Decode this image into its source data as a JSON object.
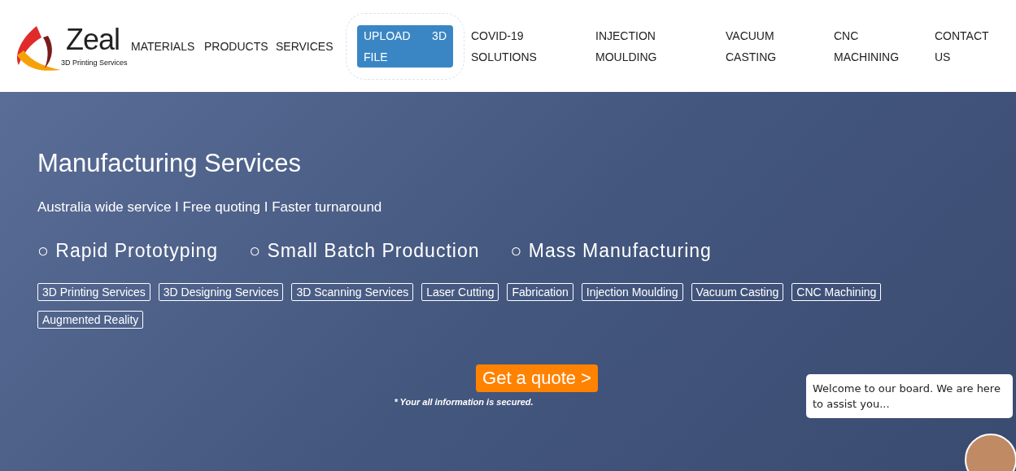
{
  "logo": {
    "name": "Zeal",
    "tagline": "3D Printing Services"
  },
  "nav": [
    {
      "kind": "link",
      "label": "MATERIALS"
    },
    {
      "kind": "link",
      "label": "PRODUCTS"
    },
    {
      "kind": "link",
      "label": "SERVICES"
    },
    {
      "kind": "button",
      "label": "UPLOAD 3D FILE"
    },
    {
      "kind": "link",
      "label": "COVID-19 SOLUTIONS"
    },
    {
      "kind": "link",
      "label": "INJECTION MOULDING"
    },
    {
      "kind": "link",
      "label": "VACUUM CASTING"
    },
    {
      "kind": "link",
      "label": "CNC MACHINING"
    },
    {
      "kind": "link",
      "label": "CONTACT US"
    }
  ],
  "hero": {
    "title": "Manufacturing Services",
    "subtitle": "Australia wide service I Free quoting I Faster turnaround",
    "offerings": [
      "○ Rapid Prototyping",
      "○ Small Batch Production",
      "○ Mass Manufacturing"
    ],
    "tags": [
      "3D Printing Services",
      "3D Designing Services",
      "3D Scanning Services",
      "Laser Cutting",
      "Fabrication",
      "Injection Moulding",
      "Vacuum Casting",
      "CNC Machining",
      "Augmented Reality"
    ],
    "cta": "Get a quote >",
    "note": "* Your all information is secured."
  },
  "chat": {
    "message": "Welcome to our board. We are here to assist you..."
  }
}
